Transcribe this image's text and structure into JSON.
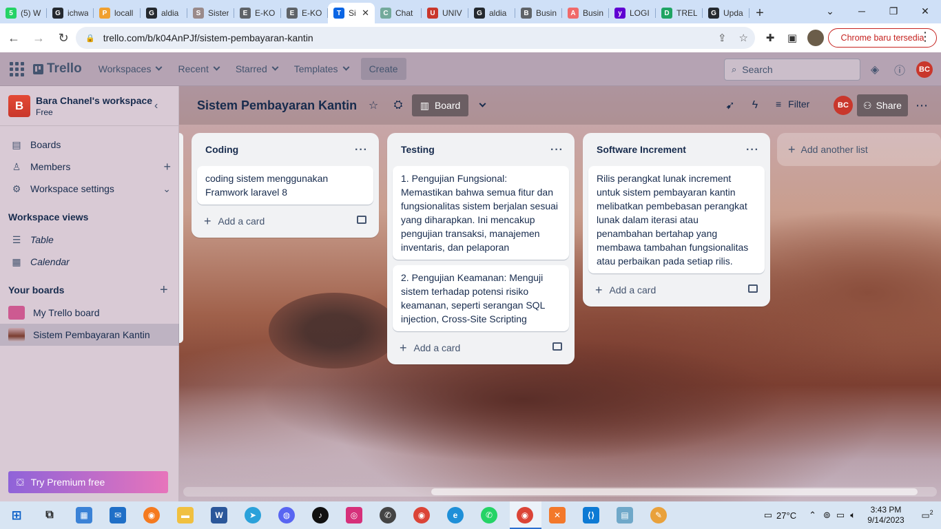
{
  "browser": {
    "tabs": [
      {
        "label": "(5) W",
        "color": "#25d366",
        "glyph": "5"
      },
      {
        "label": "ichwa",
        "color": "#24292f",
        "glyph": "G"
      },
      {
        "label": "locall",
        "color": "#f0a030",
        "glyph": "P"
      },
      {
        "label": "aldia",
        "color": "#24292f",
        "glyph": "G"
      },
      {
        "label": "Sister",
        "color": "#9a8a8a",
        "glyph": "S"
      },
      {
        "label": "E-KO",
        "color": "#5f6368",
        "glyph": "E"
      },
      {
        "label": "E-KO",
        "color": "#5f6368",
        "glyph": "E"
      },
      {
        "label": "Si",
        "color": "#0c66e4",
        "glyph": "T",
        "active": true
      },
      {
        "label": "Chat",
        "color": "#74aa9c",
        "glyph": "C"
      },
      {
        "label": "UNIV",
        "color": "#c9372c",
        "glyph": "U"
      },
      {
        "label": "aldia",
        "color": "#24292f",
        "glyph": "G"
      },
      {
        "label": "Busin",
        "color": "#5f6368",
        "glyph": "B"
      },
      {
        "label": "Busin",
        "color": "#f06a6a",
        "glyph": "A"
      },
      {
        "label": "LOGI",
        "color": "#6001d2",
        "glyph": "y"
      },
      {
        "label": "TREL",
        "color": "#1fa463",
        "glyph": "D"
      },
      {
        "label": "Upda",
        "color": "#24292f",
        "glyph": "G"
      }
    ],
    "url": "trello.com/b/k04AnPJf/sistem-pembayaran-kantin",
    "update_label": "Chrome baru tersedia"
  },
  "header": {
    "logo": "Trello",
    "menu": [
      "Workspaces",
      "Recent",
      "Starred",
      "Templates"
    ],
    "create": "Create",
    "search_placeholder": "Search",
    "avatar": "BC"
  },
  "sidebar": {
    "workspace_initial": "B",
    "workspace_name": "Bara Chanel's workspace",
    "plan": "Free",
    "items": [
      "Boards",
      "Members",
      "Workspace settings"
    ],
    "views_heading": "Workspace views",
    "views": [
      "Table",
      "Calendar"
    ],
    "boards_heading": "Your boards",
    "boards": [
      "My Trello board",
      "Sistem Pembayaran Kantin"
    ],
    "premium": "Try Premium free"
  },
  "board": {
    "title": "Sistem Pembayaran Kantin",
    "view": "Board",
    "filter": "Filter",
    "avatar": "BC",
    "share": "Share",
    "add_list": "Add another list",
    "add_card": "Add a card",
    "lists": [
      {
        "name": "Coding",
        "cards": [
          "coding sistem menggunakan Framwork laravel 8"
        ]
      },
      {
        "name": "Testing",
        "cards": [
          "1. Pengujian Fungsional: Memastikan bahwa semua fitur dan fungsionalitas sistem berjalan sesuai yang diharapkan. Ini mencakup pengujian transaksi, manajemen inventaris, dan pelaporan",
          "2. Pengujian Keamanan: Menguji sistem terhadap potensi risiko keamanan, seperti serangan SQL injection, Cross-Site Scripting"
        ]
      },
      {
        "name": "Software Increment",
        "cards": [
          "Rilis perangkat lunak increment untuk sistem pembayaran kantin melibatkan pembebasan perangkat lunak dalam iterasi atau penambahan bertahap yang membawa tambahan fungsionalitas atau perbaikan pada setiap rilis."
        ]
      }
    ]
  },
  "taskbar": {
    "weather": "27°C",
    "time": "3:43 PM",
    "date": "9/14/2023",
    "notifications": "2"
  }
}
